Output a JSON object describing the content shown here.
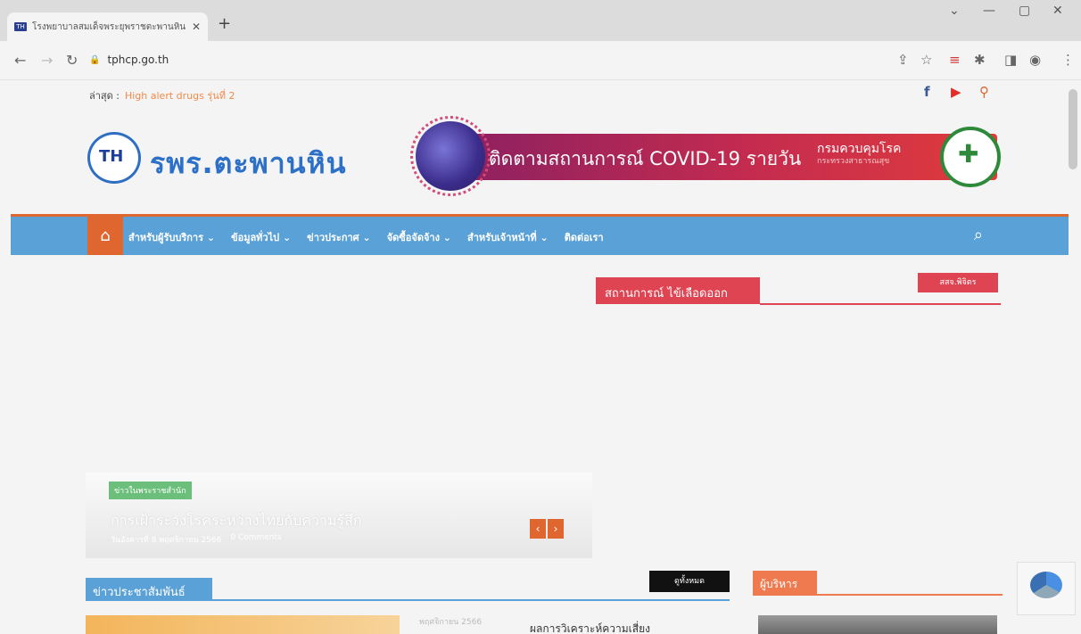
{
  "browser": {
    "tab_title": "โรงพยาบาลสมเด็จพระยุพราชตะพานหิน",
    "tab_favicon": "TH",
    "url": "tphcp.go.th"
  },
  "site": {
    "latest_label": "ล่าสุด :",
    "latest_text": "High alert drugs รุ่นที่ 2",
    "logo_text": "TH",
    "site_name": "รพร.ตะพานหิน",
    "banner_title": "ติดตามสถานการณ์ COVID-19 รายวัน",
    "banner_dept": "กรมควบคุมโรค",
    "banner_ministry": "กระทรวงสาธารณสุข",
    "menu": [
      "สำหรับผู้รับบริการ ⌄",
      "ข้อมูลทั่วไป ⌄",
      "ข่าวประกาศ ⌄",
      "จัดซื้อจัดจ้าง ⌄",
      "สำหรับเจ้าหน้าที่ ⌄",
      "ติดต่อเรา"
    ],
    "dengue_heading": "สถานการณ์ ไข้เลือดออก",
    "dengue_button": "สสจ.พิจิตร",
    "slider_tag": "ข่าวในพระราชสำนัก",
    "slider_title": "การเฝ้าระวังโรคระหว่างไทยกับความรู้สึก",
    "slider_date": "วันอังคารที่ 8 พฤศจิกายน 2566",
    "slider_comments": "0 Comments",
    "news_heading": "ข่าวประชาสัมพันธ์",
    "see_all": "ดูทั้งหมด",
    "exec_heading": "ผู้บริหาร",
    "news_item_meta": "พฤศจิกายน 2566",
    "news_item_title": "ผลการวิเคราะห์ความเสี่ยง"
  },
  "colors": {
    "nav": "#5aa1d8",
    "accent": "#e0662f",
    "dengue": "#df4453"
  }
}
